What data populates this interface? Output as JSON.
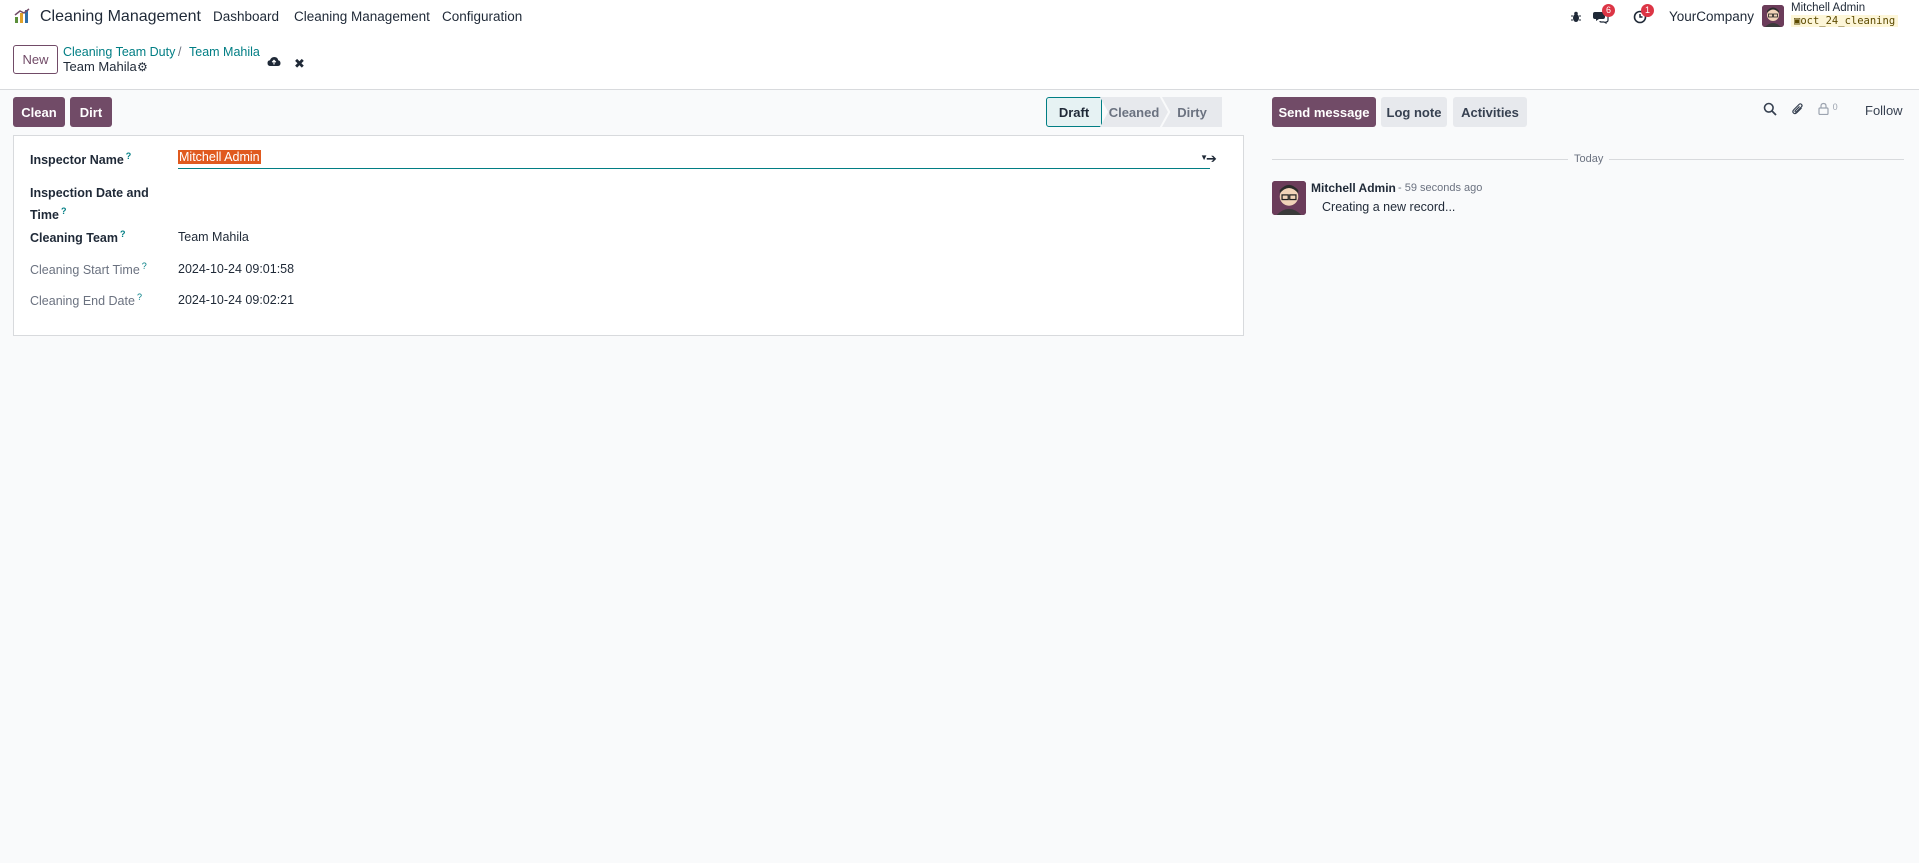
{
  "navbar": {
    "app_name": "Cleaning Management",
    "menu": [
      "Dashboard",
      "Cleaning Management",
      "Configuration"
    ],
    "messages_count": "6",
    "activities_count": "1",
    "company": "YourCompany",
    "user_name": "Mitchell Admin",
    "database": "oct_24_cleaning"
  },
  "control_panel": {
    "new_label": "New",
    "breadcrumbs": [
      "Cleaning Team Duty",
      "Team Mahila"
    ],
    "separator": "/",
    "record_title": "Team Mahila"
  },
  "actions": {
    "clean_label": "Clean",
    "dirt_label": "Dirt"
  },
  "statusbar": {
    "stages": [
      "Draft",
      "Cleaned",
      "Dirty"
    ],
    "current": "Draft"
  },
  "form": {
    "fields": [
      {
        "label": "Inspector Name",
        "value": "Mitchell Admin"
      },
      {
        "label": "Inspection Date and Time",
        "label_line1": "Inspection Date and",
        "label_line2": "Time",
        "value": ""
      },
      {
        "label": "Cleaning Team",
        "value": "Team Mahila"
      },
      {
        "label": "Cleaning Start Time",
        "value": "2024-10-24 09:01:58"
      },
      {
        "label": "Cleaning End Date",
        "value": "2024-10-24 09:02:21"
      }
    ],
    "help_mark": "?"
  },
  "chatter": {
    "send_message": "Send message",
    "log_note": "Log note",
    "activities": "Activities",
    "followers_count": "0",
    "follow": "Follow",
    "date_separator": "Today",
    "messages": [
      {
        "author": "Mitchell Admin",
        "time": "- 59 seconds ago",
        "body": "Creating a new record..."
      }
    ]
  },
  "colors": {
    "primary": "#714b67",
    "accent": "#017e84",
    "badge": "#dc3545"
  }
}
